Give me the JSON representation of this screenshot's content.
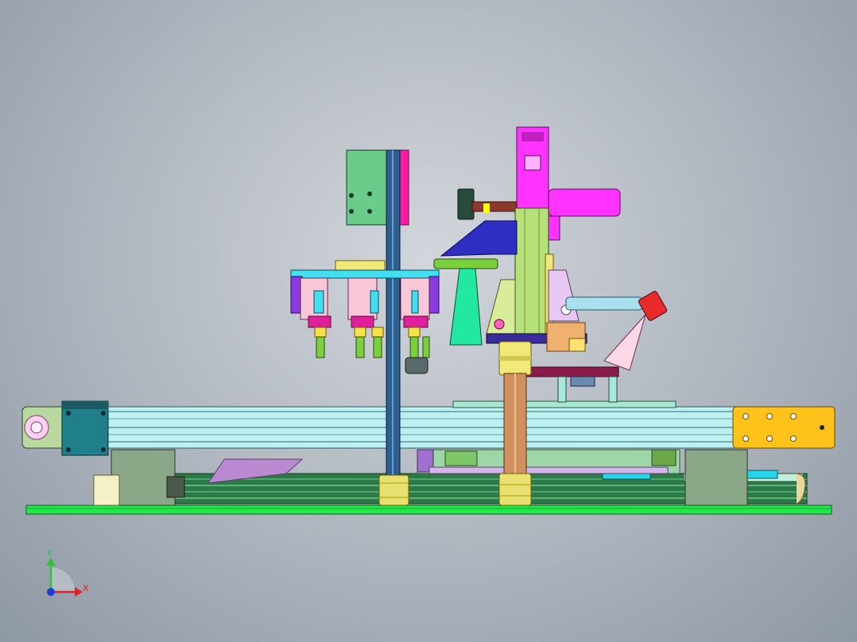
{
  "view": {
    "background_colors": [
      "#d2d6dc",
      "#b5bbc3",
      "#8e98a4"
    ]
  },
  "triad": {
    "x_label": "X",
    "y_label": "Y",
    "x_color": "#e0202a",
    "y_color": "#2cc23a",
    "origin_color": "#1a3cd8"
  },
  "model": {
    "base_plate_color": "#22e84a",
    "conveyor_color": "#bff0f0",
    "end_block_color": "#ffc21a",
    "motor_color": "#1f7f8a",
    "column_color": "#2d5f8f",
    "servo_color": "#ff33ff",
    "bracket_color": "#2e2ec2",
    "cone_color": "#22e8a0",
    "slide_color": "#b6e07a",
    "tool_color": "#ff3f8f",
    "icons": [
      "coordinate-triad-icon"
    ]
  }
}
